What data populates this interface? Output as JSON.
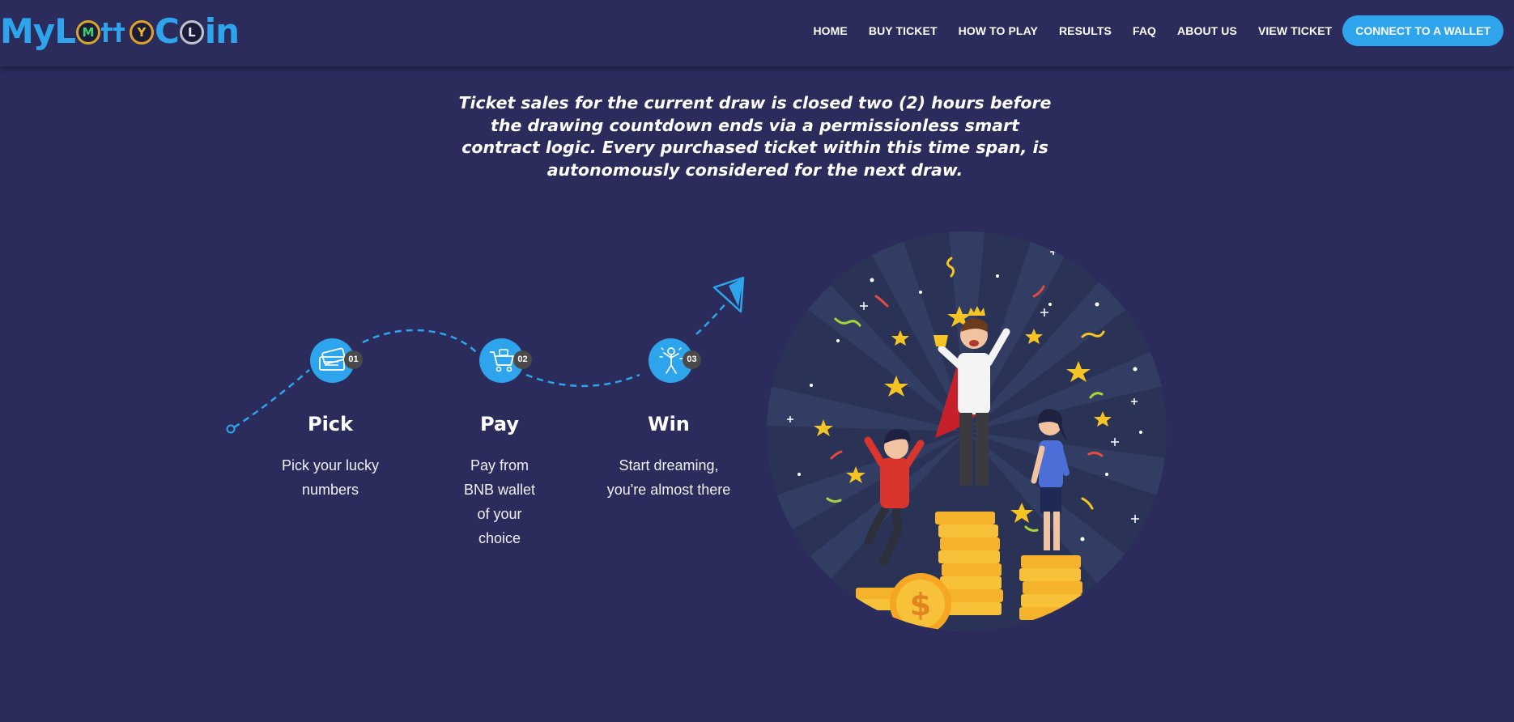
{
  "header": {
    "logo": {
      "prefix": "My",
      "coins": [
        "M",
        "Y",
        "L"
      ],
      "suffix": "Coin",
      "brand_color": "#2ea4ec"
    },
    "nav": [
      "HOME",
      "BUY TICKET",
      "HOW TO PLAY",
      "RESULTS",
      "FAQ",
      "ABOUT US",
      "VIEW TICKET"
    ],
    "wallet_button": "CONNECT TO A WALLET"
  },
  "intro": {
    "text": "Ticket sales for the current draw is closed two (2) hours before the drawing countdown ends via a permissionless smart contract logic. Every purchased ticket within this time span, is autonomously considered for the next draw."
  },
  "steps": [
    {
      "number": "01",
      "title": "Pick",
      "desc": "Pick your lucky numbers",
      "icon": "ticket-icon"
    },
    {
      "number": "02",
      "title": "Pay",
      "desc": "Pay from BNB wallet of your choice",
      "icon": "shopping-cart-icon"
    },
    {
      "number": "03",
      "title": "Win",
      "desc": "Start dreaming, you're almost there",
      "icon": "winner-icon"
    }
  ],
  "illustration": {
    "icon": "winners-podium-illustration"
  },
  "colors": {
    "background": "#2b2c5c",
    "accent": "#2ea4ec",
    "badge": "#4a4a4a"
  }
}
